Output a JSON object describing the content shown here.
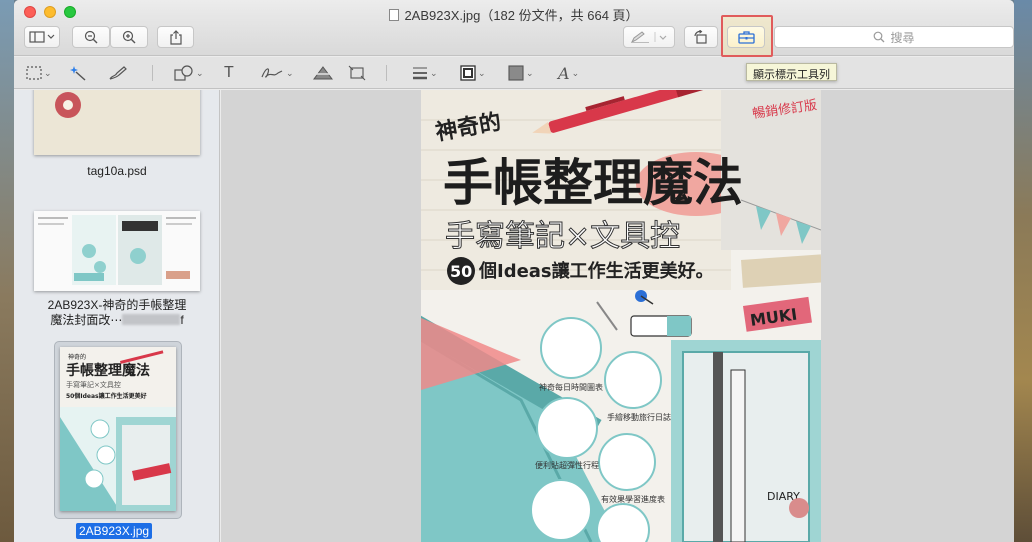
{
  "window": {
    "title": "2AB923X.jpg（182 份文件，共 664 頁）"
  },
  "toolbar": {
    "sidebar_icon": "sidebar-icon",
    "zoom_out_icon": "zoom-out-icon",
    "zoom_in_icon": "zoom-in-icon",
    "share_icon": "share-icon",
    "pen_icon": "pen-icon",
    "rotate_icon": "rotate-icon",
    "toolbox_icon": "toolbox-icon",
    "search_placeholder": "搜尋",
    "tooltip": "顯示標示工具列"
  },
  "markup": {
    "tools": [
      "selection-icon",
      "instant-alpha-icon",
      "sketch-icon",
      "shapes-icon",
      "text-icon",
      "sign-icon",
      "adjust-color-icon",
      "adjust-size-icon",
      "line-style-icon",
      "border-color-icon",
      "fill-color-icon",
      "text-style-icon"
    ]
  },
  "sidebar": {
    "items": [
      {
        "label": "tag10a.psd"
      },
      {
        "label_line1": "2AB923X-神奇的手帳整理",
        "label_line2": "魔法封面改⋯",
        "label_suffix": "f"
      },
      {
        "label": "2AB923X.jpg",
        "selected": true
      }
    ]
  },
  "cover": {
    "tag": "神奇的",
    "title": "手帳整理魔法",
    "subtitle": "手寫筆記×文具控",
    "number": "50",
    "tagline": "個Ideas讓工作生活更美好。",
    "corner_note": "暢銷修訂版",
    "brand": "MUKI",
    "notebook_label": "DIARY",
    "checklist": [
      "神奇每日時間圖表",
      "手繪移動旅行日誌",
      "便利貼超彈性行程",
      "有效果學習進度表"
    ]
  },
  "colors": {
    "highlight_border": "#e05b5b",
    "selection_blue": "#1d6ee6",
    "teal": "#7fc7c6",
    "pink": "#f0a7a0",
    "red_pen": "#d8384a"
  }
}
